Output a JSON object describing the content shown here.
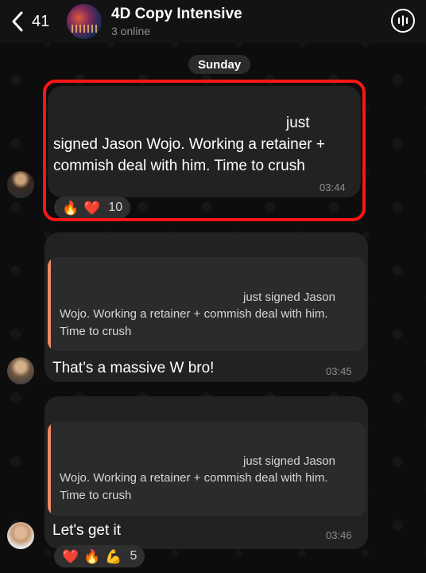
{
  "header": {
    "back_count": "41",
    "title": "4D Copy Intensive",
    "subtitle": "3 online"
  },
  "date_separator": "Sunday",
  "messages": [
    {
      "text_line1": "just",
      "text_line2": "signed Jason Wojo. Working a retainer +",
      "text_line3": "commish deal with him. Time to crush",
      "time": "03:44",
      "reactions": [
        "🔥",
        "❤️"
      ],
      "reaction_count": "10"
    },
    {
      "reply_line1": "just signed Jason",
      "reply_line2": "Wojo. Working a retainer + commish deal with him.",
      "reply_line3": "Time to crush",
      "text": "That’s a massive W bro!",
      "time": "03:45"
    },
    {
      "reply_line1": "just signed Jason",
      "reply_line2": "Wojo. Working a retainer + commish deal with him.",
      "reply_line3": "Time to crush",
      "text": "Let's get it",
      "time": "03:46",
      "reactions": [
        "❤️",
        "🔥",
        "💪"
      ],
      "reaction_count": "5"
    }
  ],
  "colors": {
    "highlight": "#ff1515",
    "reply_accent": "#f08a64",
    "bubble": "#222222"
  }
}
